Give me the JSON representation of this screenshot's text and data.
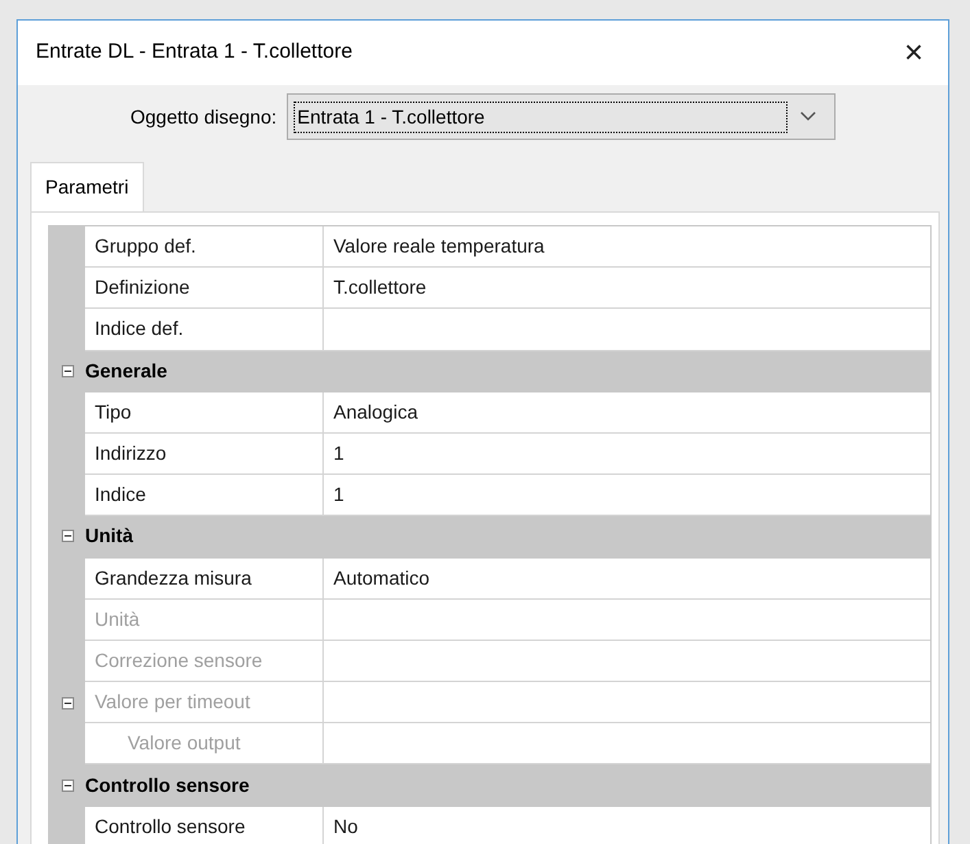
{
  "window": {
    "title": "Entrate DL - Entrata 1 - T.collettore",
    "close": "×"
  },
  "object_select": {
    "label": "Oggetto disegno:",
    "value": "Entrata 1 - T.collettore"
  },
  "tabs": [
    {
      "label": "Parametri",
      "selected": true
    }
  ],
  "properties": [
    {
      "kind": "property",
      "name": "Gruppo def.",
      "value": "Valore reale temperatura",
      "disabled": false
    },
    {
      "kind": "property",
      "name": "Definizione",
      "value": "T.collettore",
      "disabled": false
    },
    {
      "kind": "property",
      "name": "Indice def.",
      "disabled": false
    },
    {
      "kind": "category",
      "name": "Generale",
      "expanded": true,
      "children": [
        {
          "kind": "property",
          "name": "Tipo",
          "value": "Analogica",
          "disabled": false
        },
        {
          "kind": "property",
          "name": "Indirizzo",
          "value": "1",
          "disabled": false
        },
        {
          "kind": "property",
          "name": "Indice",
          "value": "1",
          "disabled": false
        }
      ]
    },
    {
      "kind": "category",
      "name": "Unità",
      "expanded": true,
      "children": [
        {
          "kind": "property",
          "name": "Grandezza misura",
          "value": "Automatico",
          "disabled": false
        },
        {
          "kind": "property",
          "name": "Unità",
          "disabled": true
        },
        {
          "kind": "property",
          "name": "Correzione sensore",
          "disabled": true
        },
        {
          "kind": "property",
          "name": "Valore per timeout",
          "disabled": true,
          "expanded": true,
          "children": [
            {
              "kind": "property",
              "name": "Valore output",
              "disabled": true
            }
          ]
        }
      ]
    },
    {
      "kind": "category",
      "name": "Controllo sensore",
      "expanded": true,
      "children": [
        {
          "kind": "property",
          "name": "Controllo sensore",
          "value": "No",
          "disabled": false
        }
      ]
    }
  ]
}
